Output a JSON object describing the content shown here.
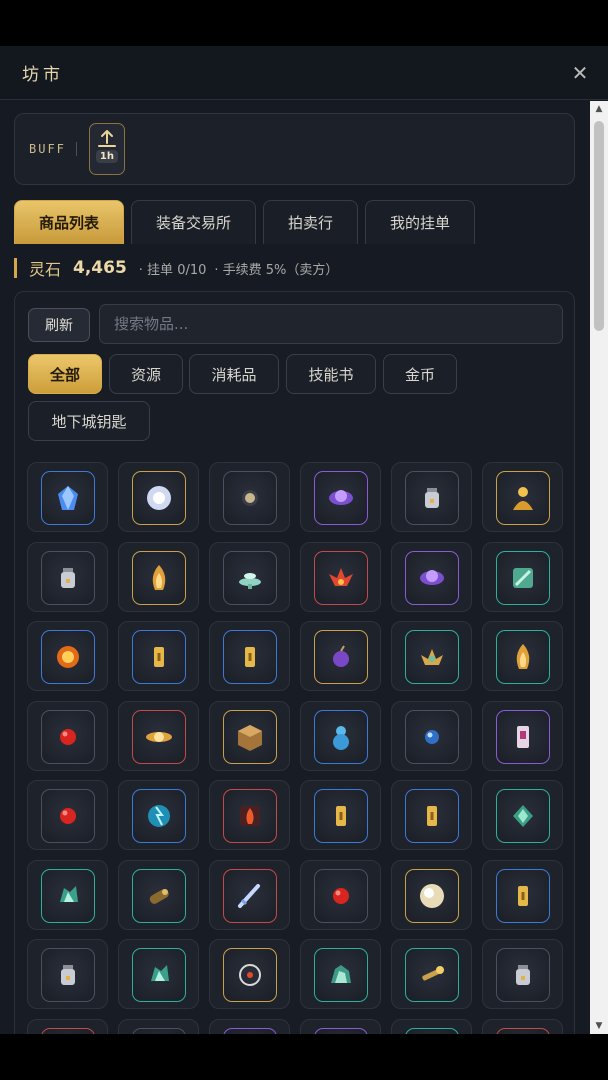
{
  "window": {
    "title": "坊市"
  },
  "buff": {
    "label": "BUFF",
    "duration": "1h"
  },
  "tabs": [
    {
      "label": "商品列表",
      "active": true
    },
    {
      "label": "装备交易所",
      "active": false
    },
    {
      "label": "拍卖行",
      "active": false
    },
    {
      "label": "我的挂单",
      "active": false
    }
  ],
  "stats": {
    "currency_label": "灵石",
    "currency_value": "4,465",
    "listings": "· 挂单 0/10",
    "fee": "· 手续费 5%（卖方）"
  },
  "search": {
    "refresh_label": "刷新",
    "placeholder": "搜索物品..."
  },
  "categories": [
    {
      "label": "全部",
      "active": true
    },
    {
      "label": "资源",
      "active": false
    },
    {
      "label": "消耗品",
      "active": false
    },
    {
      "label": "技能书",
      "active": false
    },
    {
      "label": "金币",
      "active": false
    },
    {
      "label": "地下城钥匙",
      "active": false
    }
  ],
  "items": [
    {
      "icon": "blue-crystal-icon",
      "rarity": "blue"
    },
    {
      "icon": "white-energy-orb-icon",
      "rarity": "gold"
    },
    {
      "icon": "small-pearl-icon",
      "rarity": "gray"
    },
    {
      "icon": "purple-vortex-icon",
      "rarity": "purple"
    },
    {
      "icon": "potion-jar-icon",
      "rarity": "gray"
    },
    {
      "icon": "golden-buddha-icon",
      "rarity": "gold"
    },
    {
      "icon": "potion-jar-icon",
      "rarity": "gray"
    },
    {
      "icon": "golden-flame-icon",
      "rarity": "gold"
    },
    {
      "icon": "jade-censer-icon",
      "rarity": "gray"
    },
    {
      "icon": "red-lotus-icon",
      "rarity": "red"
    },
    {
      "icon": "purple-vortex-icon",
      "rarity": "purple"
    },
    {
      "icon": "jade-scroll-icon",
      "rarity": "teal"
    },
    {
      "icon": "fire-orb-icon",
      "rarity": "blue"
    },
    {
      "icon": "gold-token-icon",
      "rarity": "blue"
    },
    {
      "icon": "gold-token-icon",
      "rarity": "blue"
    },
    {
      "icon": "purple-bomb-icon",
      "rarity": "gold"
    },
    {
      "icon": "golden-lotus-icon",
      "rarity": "teal"
    },
    {
      "icon": "golden-flame-icon",
      "rarity": "teal"
    },
    {
      "icon": "red-bead-icon",
      "rarity": "gray"
    },
    {
      "icon": "golden-gyro-icon",
      "rarity": "red"
    },
    {
      "icon": "bronze-chest-icon",
      "rarity": "gold"
    },
    {
      "icon": "spirit-gourd-icon",
      "rarity": "blue"
    },
    {
      "icon": "blue-pearl-icon",
      "rarity": "gray"
    },
    {
      "icon": "talisman-icon",
      "rarity": "purple"
    },
    {
      "icon": "red-bead-icon",
      "rarity": "gray"
    },
    {
      "icon": "lightning-orb-icon",
      "rarity": "blue"
    },
    {
      "icon": "fire-scroll-icon",
      "rarity": "red"
    },
    {
      "icon": "gold-token-icon",
      "rarity": "blue"
    },
    {
      "icon": "gold-token-icon",
      "rarity": "blue"
    },
    {
      "icon": "jade-leaf-icon",
      "rarity": "teal"
    },
    {
      "icon": "jade-crystal-icon",
      "rarity": "teal"
    },
    {
      "icon": "spirit-log-icon",
      "rarity": "teal"
    },
    {
      "icon": "flying-sword-icon",
      "rarity": "red"
    },
    {
      "icon": "red-bead-icon",
      "rarity": "gray"
    },
    {
      "icon": "pearl-orb-icon",
      "rarity": "gold"
    },
    {
      "icon": "gold-token-icon",
      "rarity": "blue"
    },
    {
      "icon": "potion-jar-icon",
      "rarity": "gray"
    },
    {
      "icon": "jade-crystal-icon",
      "rarity": "teal"
    },
    {
      "icon": "compass-icon",
      "rarity": "gold"
    },
    {
      "icon": "jade-ore-icon",
      "rarity": "teal"
    },
    {
      "icon": "golden-key-icon",
      "rarity": "teal"
    },
    {
      "icon": "potion-jar-icon",
      "rarity": "gray"
    },
    {
      "icon": "red-bead-icon",
      "rarity": "red"
    },
    {
      "icon": "pearl-orb-icon",
      "rarity": "gray"
    },
    {
      "icon": "purple-vortex-icon",
      "rarity": "purple"
    },
    {
      "icon": "purple-vortex-icon",
      "rarity": "purple"
    },
    {
      "icon": "jade-leaf-icon",
      "rarity": "teal"
    },
    {
      "icon": "red-lotus-icon",
      "rarity": "red"
    }
  ]
}
